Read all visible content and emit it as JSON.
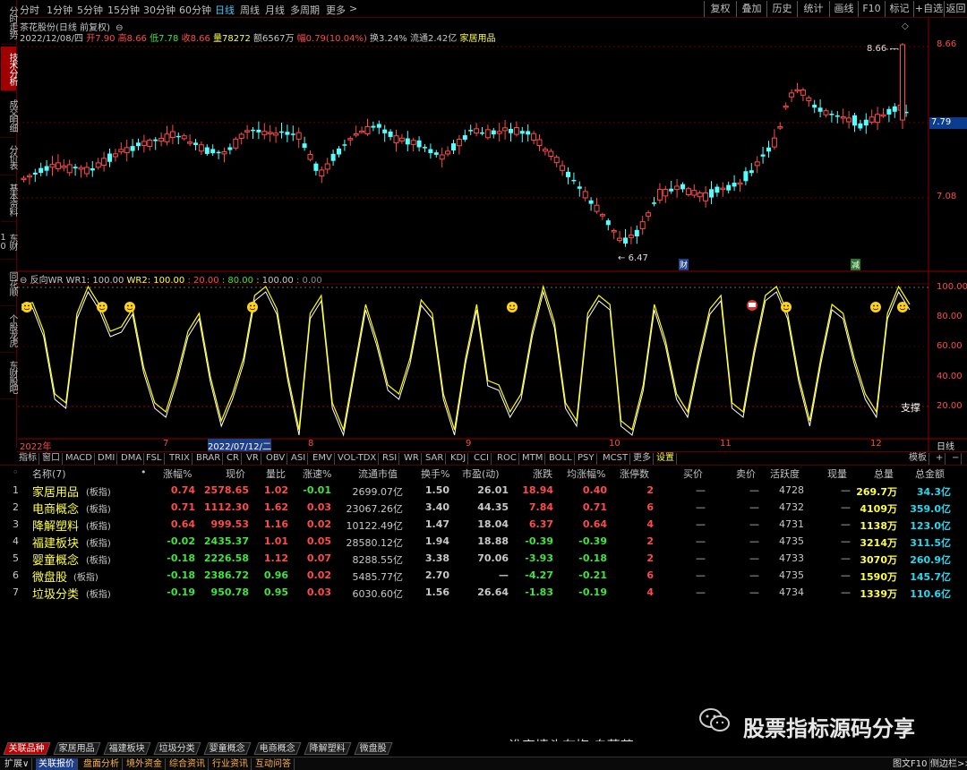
{
  "side_tabs": [
    "分时走势",
    "技术分析",
    "成交明细",
    "分价表",
    "基本资料",
    "东财10",
    "同花顺",
    "个股龙虎",
    "东财股吧"
  ],
  "periods": [
    "分时",
    "1分钟",
    "5分钟",
    "15分钟",
    "30分钟",
    "60分钟",
    "日线",
    "周线",
    "月线",
    "多周期",
    "更多"
  ],
  "right_buttons": [
    "复权",
    "叠加",
    "历史",
    "统计",
    "画线",
    "F10",
    "标记",
    "+自选",
    "返回"
  ],
  "stock": {
    "title": "茶花股份(日线 前复权)",
    "date": "2022/12/08/四",
    "open_label": "开",
    "open": "7.90",
    "high_label": "高",
    "high": "8.66",
    "low_label": "低",
    "low": "7.78",
    "close_label": "收",
    "close": "8.66",
    "vol_label": "量",
    "vol": "78272",
    "amt_label": "额",
    "amt": "6567万",
    "chg_label": "幅",
    "chg": "0.79(10.04%)",
    "turn": "换3.24%",
    "float": "流通2.42亿",
    "sector": "家居用品",
    "axis_labels": [
      "8.66",
      "7.79",
      "7.08"
    ],
    "max_label": "8.66",
    "min_label": "6.47",
    "tag_cai": "财",
    "tag_jian": "减",
    "last_price": "7.79"
  },
  "wr": {
    "title": "反向WR",
    "wr1_label": "WR1: 100.00",
    "wr2_label": "WR2: 100.00",
    "v20": ": 20.00",
    "v80": ": 80.00",
    "v100": ": 100.00",
    "v0": ": 0.00",
    "axis": [
      "100.00",
      "80.00",
      "60.00",
      "40.00",
      "20.00"
    ],
    "support": "支撑"
  },
  "time_axis": [
    "2022年",
    "7",
    "2022/07/12/二",
    "8",
    "9",
    "10",
    "11",
    "12"
  ],
  "time_axis_right": "日线",
  "indicator_tabs": [
    "指标",
    "窗口",
    "MACD",
    "DMI",
    "DMA",
    "FSL",
    "TRIX",
    "BRAR",
    "CR",
    "VR",
    "OBV",
    "ASI",
    "EMV",
    "VOL-TDX",
    "RSI",
    "WR",
    "SAR",
    "KDJ",
    "CCI",
    "ROC",
    "MTM",
    "BOLL",
    "PSY",
    "MCST",
    "更多",
    "设置"
  ],
  "indicator_right": "模板",
  "table": {
    "headers": [
      "名称(7)",
      "•",
      "涨幅%",
      "现价",
      "量比",
      "涨速%",
      "流通市值",
      "换手%",
      "市盈(动)",
      "涨跌",
      "均涨幅%",
      "涨停数",
      "买价",
      "卖价",
      "活跃度",
      "现量",
      "总量",
      "总金额"
    ],
    "rows": [
      {
        "idx": "1",
        "name": "家居用品",
        "tag": "(板指)",
        "zf": "0.74",
        "xj": "2578.65",
        "lb": "1.02",
        "zs": "-0.01",
        "ltsz": "2699.07亿",
        "hs": "1.50",
        "syl": "26.01",
        "zd": "18.94",
        "jzf": "0.40",
        "zts": "2",
        "mj": "—",
        "mc": "—",
        "hyd": "4728",
        "xl": "—",
        "zl": "269.7万",
        "zje": "34.3亿"
      },
      {
        "idx": "2",
        "name": "电商概念",
        "tag": "(板指)",
        "zf": "0.71",
        "xj": "1112.30",
        "lb": "1.62",
        "zs": "0.03",
        "ltsz": "23067.26亿",
        "hs": "3.40",
        "syl": "44.35",
        "zd": "7.84",
        "jzf": "0.71",
        "zts": "6",
        "mj": "—",
        "mc": "—",
        "hyd": "4732",
        "xl": "—",
        "zl": "4109万",
        "zje": "359.0亿"
      },
      {
        "idx": "3",
        "name": "降解塑料",
        "tag": "(板指)",
        "zf": "0.64",
        "xj": "999.53",
        "lb": "1.16",
        "zs": "0.02",
        "ltsz": "10122.49亿",
        "hs": "1.47",
        "syl": "18.04",
        "zd": "6.37",
        "jzf": "0.64",
        "zts": "4",
        "mj": "—",
        "mc": "—",
        "hyd": "4731",
        "xl": "—",
        "zl": "1138万",
        "zje": "123.0亿"
      },
      {
        "idx": "4",
        "name": "福建板块",
        "tag": "(板指)",
        "zf": "-0.02",
        "xj": "2435.37",
        "lb": "1.01",
        "zs": "0.05",
        "ltsz": "28580.12亿",
        "hs": "1.94",
        "syl": "18.88",
        "zd": "-0.39",
        "jzf": "-0.39",
        "zts": "2",
        "mj": "—",
        "mc": "—",
        "hyd": "4735",
        "xl": "—",
        "zl": "3214万",
        "zje": "311.5亿"
      },
      {
        "idx": "5",
        "name": "婴童概念",
        "tag": "(板指)",
        "zf": "-0.18",
        "xj": "2226.58",
        "lb": "1.12",
        "zs": "0.07",
        "ltsz": "8288.55亿",
        "hs": "3.38",
        "syl": "70.06",
        "zd": "-3.93",
        "jzf": "-0.18",
        "zts": "2",
        "mj": "—",
        "mc": "—",
        "hyd": "4733",
        "xl": "—",
        "zl": "3070万",
        "zje": "260.9亿"
      },
      {
        "idx": "6",
        "name": "微盘股",
        "tag": "(板指)",
        "zf": "-0.18",
        "xj": "2386.72",
        "lb": "0.96",
        "zs": "0.02",
        "ltsz": "5485.77亿",
        "hs": "2.70",
        "syl": "—",
        "zd": "-4.27",
        "jzf": "-0.21",
        "zts": "6",
        "mj": "—",
        "mc": "—",
        "hyd": "4735",
        "xl": "—",
        "zl": "1590万",
        "zje": "145.7亿"
      },
      {
        "idx": "7",
        "name": "垃圾分类",
        "tag": "(板指)",
        "zf": "-0.19",
        "xj": "950.78",
        "lb": "0.95",
        "zs": "0.03",
        "ltsz": "6030.60亿",
        "hs": "1.56",
        "syl": "26.64",
        "zd": "-1.83",
        "jzf": "-0.19",
        "zts": "4",
        "mj": "—",
        "mc": "—",
        "hyd": "4734",
        "xl": "—",
        "zl": "1339万",
        "zje": "110.6亿"
      }
    ]
  },
  "watermark": {
    "brand": "股票指标源码分享",
    "signature": "谁家墙头有梅 自芬芳"
  },
  "bottom_tabs": [
    "关联品种",
    "家居用品",
    "福建板块",
    "垃圾分类",
    "婴童概念",
    "电商概念",
    "降解塑料",
    "微盘股"
  ],
  "status": [
    "扩展∨",
    "关联报价",
    "盘面分析",
    "境外资金",
    "综合资讯",
    "行业资讯",
    "互动问答"
  ],
  "status_right": [
    "图文F10",
    "侧边栏>>"
  ],
  "colors": {
    "up": "#ff4a4a",
    "down": "#54ffff",
    "wr1": "#ffffff",
    "wr2": "#ffff00",
    "accent": "#c00000"
  }
}
